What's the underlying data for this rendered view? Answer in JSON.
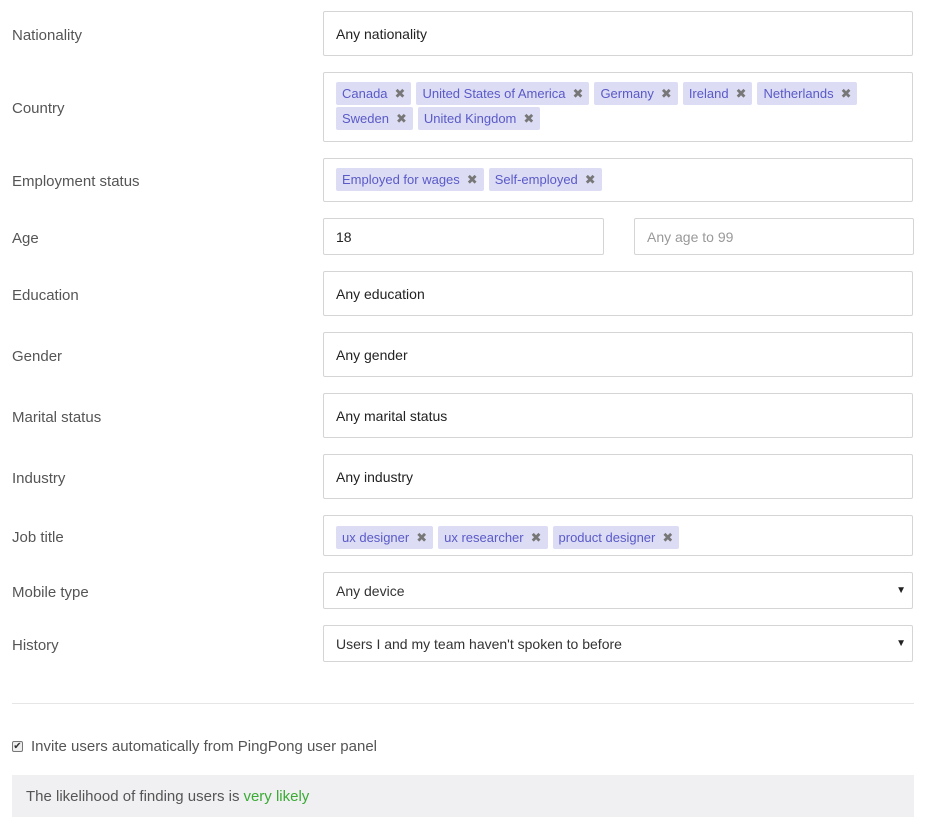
{
  "nationality": {
    "label": "Nationality",
    "value": "Any nationality"
  },
  "country": {
    "label": "Country",
    "tags": [
      "Canada",
      "United States of America",
      "Germany",
      "Ireland",
      "Netherlands",
      "Sweden",
      "United Kingdom"
    ]
  },
  "employment": {
    "label": "Employment status",
    "tags": [
      "Employed for wages",
      "Self-employed"
    ]
  },
  "age": {
    "label": "Age",
    "min_value": "18",
    "max_placeholder": "Any age to 99"
  },
  "education": {
    "label": "Education",
    "value": "Any education"
  },
  "gender": {
    "label": "Gender",
    "value": "Any gender"
  },
  "marital": {
    "label": "Marital status",
    "value": "Any marital status"
  },
  "industry": {
    "label": "Industry",
    "value": "Any industry"
  },
  "job_title": {
    "label": "Job title",
    "tags": [
      "ux designer",
      "ux researcher",
      "product designer"
    ]
  },
  "mobile": {
    "label": "Mobile type",
    "value": "Any device"
  },
  "history": {
    "label": "History",
    "value": "Users I and my team haven't spoken to before"
  },
  "invite": {
    "label": "Invite users automatically from PingPong user panel",
    "checked": true
  },
  "likelihood": {
    "prefix": "The likelihood of finding users is",
    "value": "very likely",
    "value_color": "#3aaa35"
  },
  "tag_remove_glyph": "✖",
  "caret_glyph": "▼",
  "check_glyph": "✔"
}
